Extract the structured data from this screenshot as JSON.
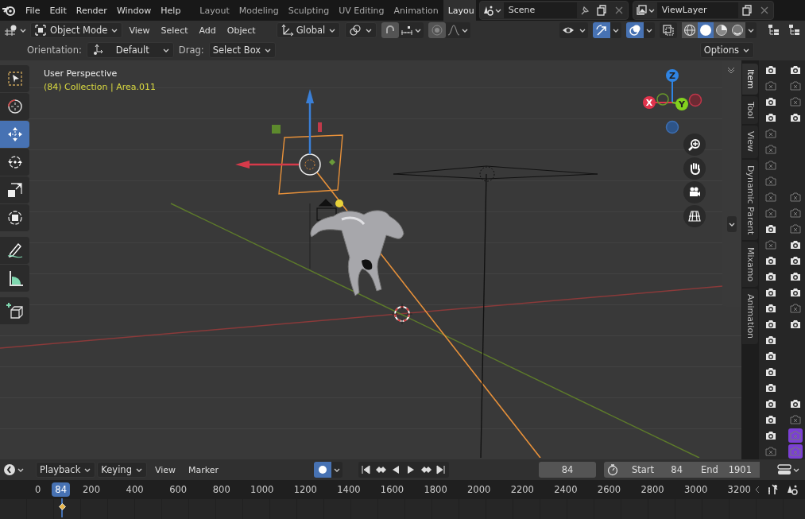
{
  "top_bar": {
    "menus": [
      "File",
      "Edit",
      "Render",
      "Window",
      "Help"
    ],
    "workspaces": [
      {
        "label": "Layout",
        "selected": false
      },
      {
        "label": "Modeling",
        "selected": false
      },
      {
        "label": "Sculpting",
        "selected": false
      },
      {
        "label": "UV Editing",
        "selected": false
      },
      {
        "label": "Animation",
        "selected": false
      },
      {
        "label": "Layou",
        "selected": true
      }
    ],
    "scene": "Scene",
    "view_layer": "ViewLayer"
  },
  "viewport_header": {
    "mode": "Object Mode",
    "menus": [
      "View",
      "Select",
      "Add",
      "Object"
    ],
    "orientation": "Global",
    "toggles": [
      {
        "kind": "visibility",
        "on": false
      },
      {
        "kind": "gizmo",
        "on": true
      },
      {
        "kind": "overlay",
        "on": true
      },
      {
        "kind": "xray",
        "on": false
      }
    ],
    "shading": [
      {
        "kind": "wireframe",
        "selected": false
      },
      {
        "kind": "solid",
        "selected": true
      },
      {
        "kind": "material",
        "selected": false
      },
      {
        "kind": "rendered",
        "selected": false
      }
    ]
  },
  "tool_settings": {
    "orientation_label": "Orientation:",
    "orientation": "Default",
    "drag_label": "Drag:",
    "drag": "Select Box",
    "options": "Options"
  },
  "toolbar": [
    {
      "kind": "select",
      "selected": false
    },
    {
      "kind": "cursor",
      "selected": false
    },
    {
      "kind": "move",
      "selected": true
    },
    {
      "kind": "rotate",
      "selected": false
    },
    {
      "kind": "scale",
      "selected": false
    },
    {
      "kind": "transform",
      "selected": false
    },
    {
      "kind": "annotate",
      "selected": false
    },
    {
      "kind": "measure",
      "selected": false
    },
    {
      "kind": "add_cube",
      "selected": false
    }
  ],
  "viewport": {
    "view_name": "User Perspective",
    "object_info": "(84) Collection | Area.011",
    "axes": [
      {
        "kind": "x",
        "label": "X"
      },
      {
        "kind": "y",
        "label": "Y"
      },
      {
        "kind": "z",
        "label": "Z"
      }
    ]
  },
  "sidebar_tabs": [
    {
      "label": "Item",
      "selected": true
    },
    {
      "label": "Tool",
      "selected": false
    },
    {
      "label": "View",
      "selected": false
    },
    {
      "label": "Dynamic Parent",
      "selected": false
    },
    {
      "label": "Mixamo",
      "selected": false
    },
    {
      "label": "Animation",
      "selected": false
    }
  ],
  "outliner": {
    "rows": [
      {
        "render_a": true,
        "render_b": true
      },
      {
        "render_a": false,
        "render_b": false
      },
      {
        "render_a": true,
        "render_b": false
      },
      {
        "render_a": true,
        "render_b": true
      },
      {
        "render_a": false
      },
      {
        "render_a": false
      },
      {
        "render_a": false
      },
      {
        "render_a": false
      },
      {
        "render_a": false,
        "render_b": false
      },
      {
        "render_a": false,
        "render_b": false
      },
      {
        "render_a": true,
        "render_b": false
      },
      {
        "render_a": false,
        "render_b": true
      },
      {
        "render_a": true,
        "render_b": true
      },
      {
        "render_a": true,
        "render_b": true
      },
      {
        "render_a": true,
        "render_b": true
      },
      {
        "render_a": true,
        "render_b": false
      },
      {
        "render_a": true,
        "render_b": true
      },
      {
        "render_a": true
      },
      {
        "render_a": true
      },
      {
        "render_a": true
      },
      {
        "render_a": true
      },
      {
        "render_a": true,
        "render_b": true
      },
      {
        "render_a": true,
        "render_b": false
      },
      {
        "render_a": true,
        "render_b": false,
        "selected": true
      },
      {
        "render_a": false,
        "render_b": false,
        "selected": true
      }
    ]
  },
  "timeline": {
    "menus": [
      "Playback",
      "Keying",
      "View",
      "Marker"
    ],
    "auto_keying": true,
    "current_frame": "84",
    "start_label": "Start",
    "start": "84",
    "end_label": "End",
    "end": "1901",
    "ruler": [
      {
        "label": "0",
        "current": false
      },
      {
        "label": "84",
        "current": true
      },
      {
        "label": "200",
        "current": false
      },
      {
        "label": "400",
        "current": false
      },
      {
        "label": "600",
        "current": false
      },
      {
        "label": "800",
        "current": false
      },
      {
        "label": "1000",
        "current": false
      },
      {
        "label": "1200",
        "current": false
      },
      {
        "label": "1400",
        "current": false
      },
      {
        "label": "1600",
        "current": false
      },
      {
        "label": "1800",
        "current": false
      },
      {
        "label": "2000",
        "current": false
      },
      {
        "label": "2200",
        "current": false
      },
      {
        "label": "2400",
        "current": false
      },
      {
        "label": "2600",
        "current": false
      },
      {
        "label": "2800",
        "current": false
      },
      {
        "label": "3000",
        "current": false
      },
      {
        "label": "3200",
        "current": false
      }
    ]
  }
}
